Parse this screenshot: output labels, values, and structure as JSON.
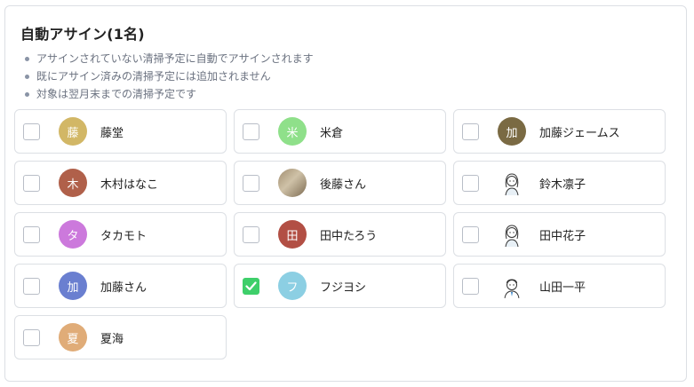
{
  "title": "自動アサイン(1名)",
  "notes": [
    "アサインされていない清掃予定に自動でアサインされます",
    "既にアサイン済みの清掃予定には追加されません",
    "対象は翌月末までの清掃予定です"
  ],
  "members": [
    {
      "name": "藤堂",
      "initial": "藤",
      "avatar": "initial",
      "color": "#d2b766",
      "checked": false
    },
    {
      "name": "米倉",
      "initial": "米",
      "avatar": "initial",
      "color": "#8fe08a",
      "checked": false
    },
    {
      "name": "加藤ジェームス",
      "initial": "加",
      "avatar": "initial",
      "color": "#7a6a43",
      "checked": false
    },
    {
      "name": "木村はなこ",
      "initial": "木",
      "avatar": "initial",
      "color": "#b0604a",
      "checked": false
    },
    {
      "name": "後藤さん",
      "initial": "",
      "avatar": "photo",
      "color": "#a18d6f",
      "checked": false
    },
    {
      "name": "鈴木凛子",
      "initial": "",
      "avatar": "illustration-woman-icon",
      "color": "#ffffff",
      "checked": false
    },
    {
      "name": "タカモト",
      "initial": "タ",
      "avatar": "initial",
      "color": "#cc79dc",
      "checked": false
    },
    {
      "name": "田中たろう",
      "initial": "田",
      "avatar": "initial",
      "color": "#b24f44",
      "checked": false
    },
    {
      "name": "田中花子",
      "initial": "",
      "avatar": "illustration-woman-icon",
      "color": "#ffffff",
      "checked": false
    },
    {
      "name": "加藤さん",
      "initial": "加",
      "avatar": "initial",
      "color": "#6a7fd0",
      "checked": false
    },
    {
      "name": "フジヨシ",
      "initial": "フ",
      "avatar": "initial",
      "color": "#8ccfe3",
      "checked": true
    },
    {
      "name": "山田一平",
      "initial": "",
      "avatar": "illustration-man-icon",
      "color": "#ffffff",
      "checked": false
    },
    {
      "name": "夏海",
      "initial": "夏",
      "avatar": "initial",
      "color": "#e0ac78",
      "checked": false
    }
  ],
  "colors": {
    "check_accent": "#3ecf6a",
    "border": "#dcdfe4",
    "note_text": "#6b7280"
  }
}
